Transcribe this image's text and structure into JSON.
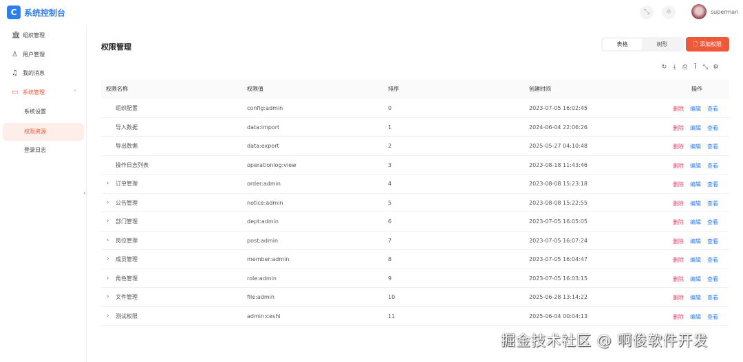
{
  "app": {
    "title": "系统控制台",
    "user": "superman"
  },
  "sidebar": {
    "items": [
      {
        "label": "组织管理",
        "icon": "bank-icon"
      },
      {
        "label": "用户管理",
        "icon": "user-icon"
      },
      {
        "label": "我的消息",
        "icon": "bell-icon"
      },
      {
        "label": "系统管理",
        "icon": "monitor-icon"
      },
      {
        "label": "系统设置"
      },
      {
        "label": "权限资源"
      },
      {
        "label": "登录日志"
      }
    ]
  },
  "page": {
    "title": "权限管理",
    "view_table": "表格",
    "view_tree": "树形",
    "add_label": "添加权限"
  },
  "table": {
    "headers": [
      "权限名称",
      "权限值",
      "排序",
      "创建时间",
      "操作"
    ],
    "actions": {
      "delete": "删除",
      "edit": "编辑",
      "view": "查看"
    },
    "rows": [
      {
        "name": "组织配置",
        "value": "config:admin",
        "sort": "0",
        "time": "2023-07-05 16:02:45",
        "expandable": false
      },
      {
        "name": "导入数据",
        "value": "data:import",
        "sort": "1",
        "time": "2024-06-04 22:06:26",
        "expandable": false
      },
      {
        "name": "导出数据",
        "value": "data:export",
        "sort": "2",
        "time": "2025-05-27 04:10:48",
        "expandable": false
      },
      {
        "name": "操作日志列表",
        "value": "operationlog:view",
        "sort": "3",
        "time": "2023-08-18 11:43:46",
        "expandable": false
      },
      {
        "name": "订单管理",
        "value": "order:admin",
        "sort": "4",
        "time": "2023-08-08 15:23:18",
        "expandable": true
      },
      {
        "name": "公告管理",
        "value": "notice:admin",
        "sort": "5",
        "time": "2023-08-08 15:22:55",
        "expandable": true
      },
      {
        "name": "部门管理",
        "value": "dept:admin",
        "sort": "6",
        "time": "2023-07-05 16:05:05",
        "expandable": true
      },
      {
        "name": "岗位管理",
        "value": "post:admin",
        "sort": "7",
        "time": "2023-07-05 16:07:24",
        "expandable": true
      },
      {
        "name": "成员管理",
        "value": "member:admin",
        "sort": "8",
        "time": "2023-07-05 16:04:47",
        "expandable": true
      },
      {
        "name": "角色管理",
        "value": "role:admin",
        "sort": "9",
        "time": "2023-07-05 16:03:15",
        "expandable": true
      },
      {
        "name": "文件管理",
        "value": "file:admin",
        "sort": "10",
        "time": "2025-06-28 13:14:22",
        "expandable": true
      },
      {
        "name": "测试权限",
        "value": "admin:ceshi",
        "sort": "11",
        "time": "2025-06-04 00:04:13",
        "expandable": true
      }
    ]
  },
  "watermark": "掘金技术社区 @ 啊俊软件开发",
  "colors": {
    "accent": "#f0583a",
    "brand": "#2d7ff0",
    "danger": "#e0446a"
  }
}
